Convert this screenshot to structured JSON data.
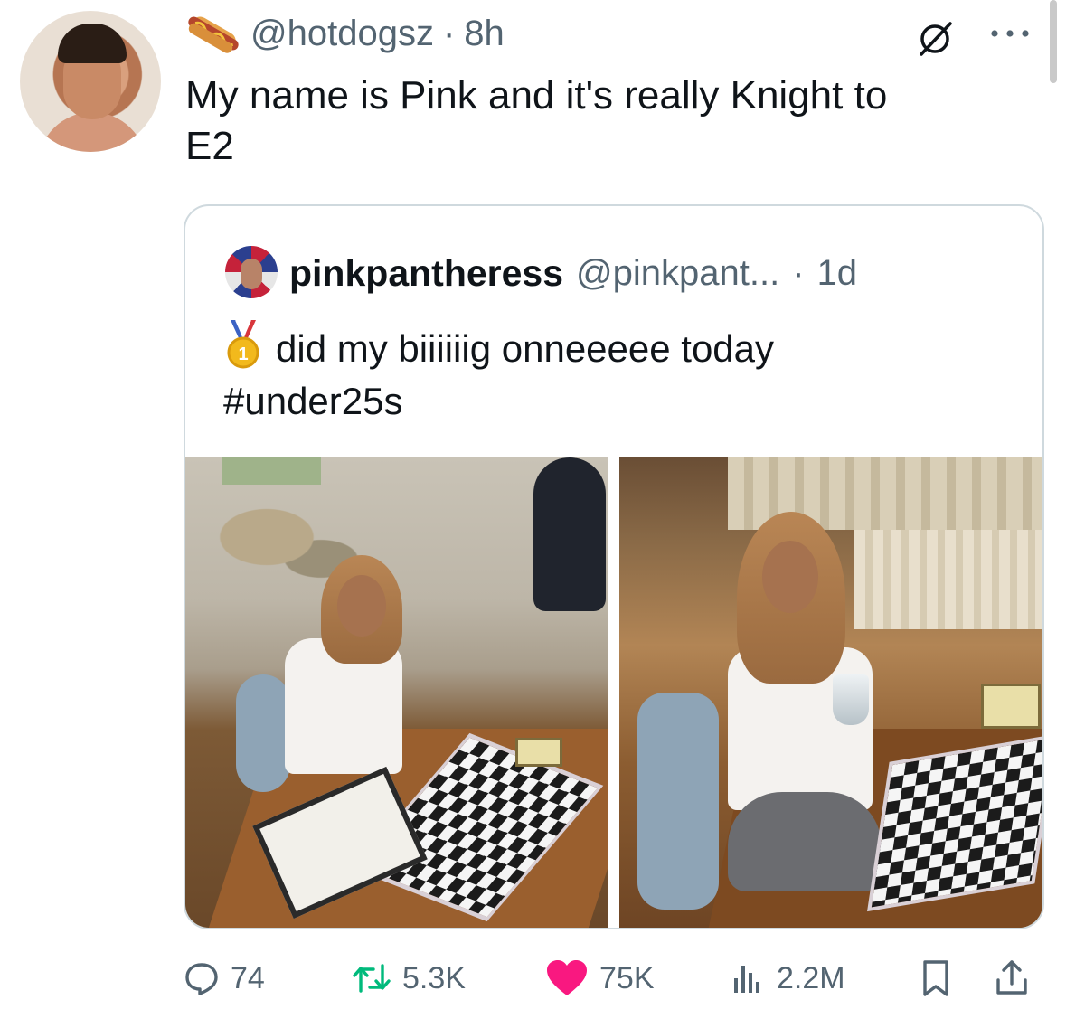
{
  "tweet": {
    "handle": "@hotdogsz",
    "separator": "·",
    "time": "8h",
    "text": "My name is Pink and it's really Knight to\nE2",
    "icons": {
      "badge": "hotdog-icon",
      "grok": "grok-icon",
      "more": "more-icon"
    }
  },
  "quoted_tweet": {
    "display_name": "pinkpantheress",
    "handle": "@pinkpant...",
    "separator": "·",
    "time": "1d",
    "text": "did my biiiiiig onneeeee today",
    "hashtag": "#under25s",
    "emoji": "first-place-medal-icon",
    "photos": [
      "chess-photo-left",
      "chess-photo-right"
    ]
  },
  "actions": {
    "replies": "74",
    "reposts": "5.3K",
    "likes": "75K",
    "views": "2.2M",
    "like_color": "#f91880",
    "icons": [
      "reply-icon",
      "retweet-icon",
      "heart-icon",
      "views-icon",
      "bookmark-icon",
      "share-icon"
    ]
  }
}
